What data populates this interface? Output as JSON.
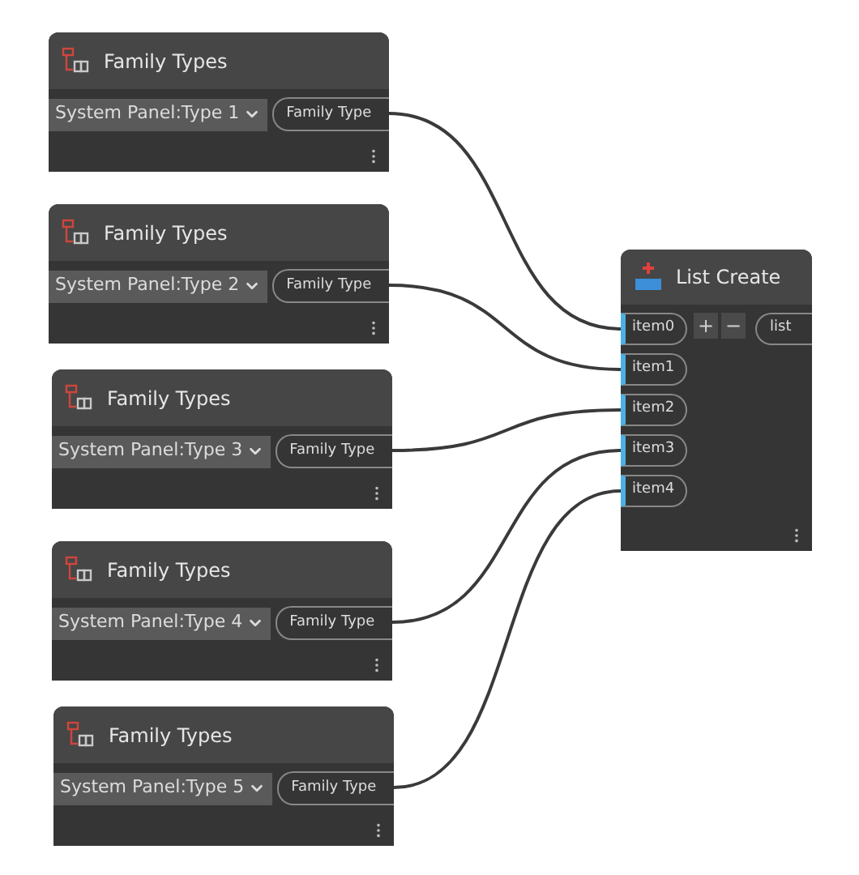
{
  "family_nodes": [
    {
      "title": "Family Types",
      "value": "System Panel:Type 1",
      "output": "Family Type"
    },
    {
      "title": "Family Types",
      "value": "System Panel:Type 2",
      "output": "Family Type"
    },
    {
      "title": "Family Types",
      "value": "System Panel:Type 3",
      "output": "Family Type"
    },
    {
      "title": "Family Types",
      "value": "System Panel:Type 4",
      "output": "Family Type"
    },
    {
      "title": "Family Types",
      "value": "System Panel:Type 5",
      "output": "Family Type"
    }
  ],
  "list_node": {
    "title": "List Create",
    "inputs": [
      "item0",
      "item1",
      "item2",
      "item3",
      "item4"
    ],
    "add_button": "+",
    "remove_button": "−",
    "output": "list"
  }
}
